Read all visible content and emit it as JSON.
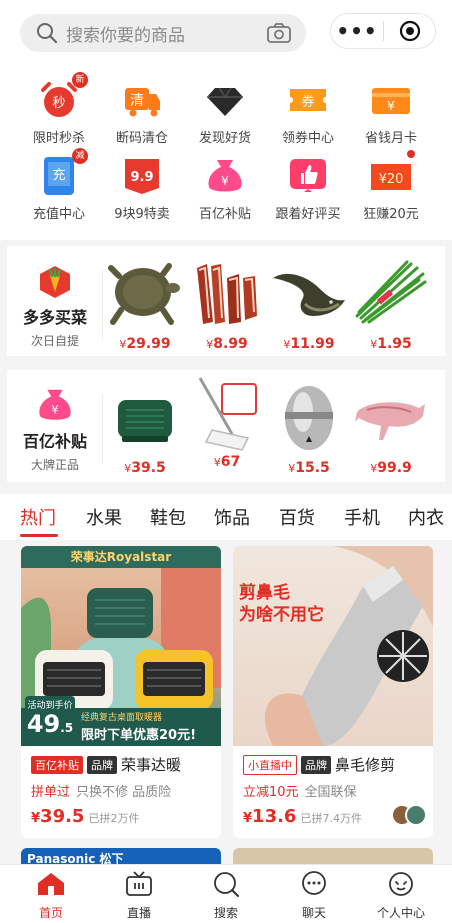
{
  "search": {
    "placeholder": "搜索你要的商品"
  },
  "capsule": {
    "more": "•••"
  },
  "grid": [
    {
      "label": "限时秒杀",
      "icon": "alarm-clock-icon",
      "glyph": "秒",
      "badge": "新"
    },
    {
      "label": "断码清仓",
      "icon": "truck-icon",
      "glyph": "清"
    },
    {
      "label": "发现好货",
      "icon": "diamond-icon"
    },
    {
      "label": "领券中心",
      "icon": "coupon-icon",
      "glyph": "券"
    },
    {
      "label": "省钱月卡",
      "icon": "card-icon",
      "glyph": "¥"
    },
    {
      "label": "充值中心",
      "icon": "phone-recharge-icon",
      "glyph": "充",
      "badge": "减"
    },
    {
      "label": "9块9特卖",
      "icon": "tag-icon",
      "glyph": "9.9"
    },
    {
      "label": "百亿补贴",
      "icon": "money-bag-icon",
      "glyph": "¥"
    },
    {
      "label": "跟着好评买",
      "icon": "thumbs-up-icon"
    },
    {
      "label": "狂赚20元",
      "icon": "red-packet-icon",
      "glyph": "¥20"
    }
  ],
  "grocery": {
    "title": "多多买菜",
    "subtitle": "次日自提",
    "products": [
      {
        "name": "turtle",
        "price": "29.99"
      },
      {
        "name": "bacon",
        "price": "8.99"
      },
      {
        "name": "eel",
        "price": "11.99"
      },
      {
        "name": "chives",
        "price": "1.95"
      }
    ]
  },
  "subsidy": {
    "title": "百亿补贴",
    "subtitle": "大牌正品",
    "products": [
      {
        "name": "heater",
        "price": "39.5"
      },
      {
        "name": "mop",
        "price": "67"
      },
      {
        "name": "egg-timer",
        "price": "15.5"
      },
      {
        "name": "lamb",
        "price": "99.9"
      }
    ]
  },
  "tabs": [
    "热门",
    "水果",
    "鞋包",
    "饰品",
    "百货",
    "手机",
    "内衣"
  ],
  "cards": [
    {
      "brand_logo": "荣事达Royalstar",
      "promo_small": "活动到手价",
      "promo_price": "49",
      "promo_price_dec": ".5",
      "promo_sub": "经典复古桌面取暖器",
      "promo_banner": "限时下单优惠20元!",
      "tag1": "百亿补贴",
      "tag2": "品牌",
      "title": "荣事达暖",
      "line_red": "拼单过",
      "line_gray": "只换不修 品质险",
      "price": "39.5",
      "sold": "已拼2万件"
    },
    {
      "headline1": "剪鼻毛",
      "headline2": "为啥不用它",
      "tag1": "小直播中",
      "tag2": "品牌",
      "title": "鼻毛修剪",
      "line_red": "立减10元",
      "line_gray": "全国联保",
      "price": "13.6",
      "sold": "已拼7.4万件"
    }
  ],
  "peek": {
    "left_text": "Panasonic 松下"
  },
  "nav": [
    {
      "label": "首页",
      "icon": "home-icon"
    },
    {
      "label": "直播",
      "icon": "tv-icon"
    },
    {
      "label": "搜索",
      "icon": "search-icon"
    },
    {
      "label": "聊天",
      "icon": "chat-icon"
    },
    {
      "label": "个人中心",
      "icon": "profile-icon"
    }
  ],
  "colors": {
    "accent": "#e02e24",
    "orange": "#ff7a1a"
  }
}
